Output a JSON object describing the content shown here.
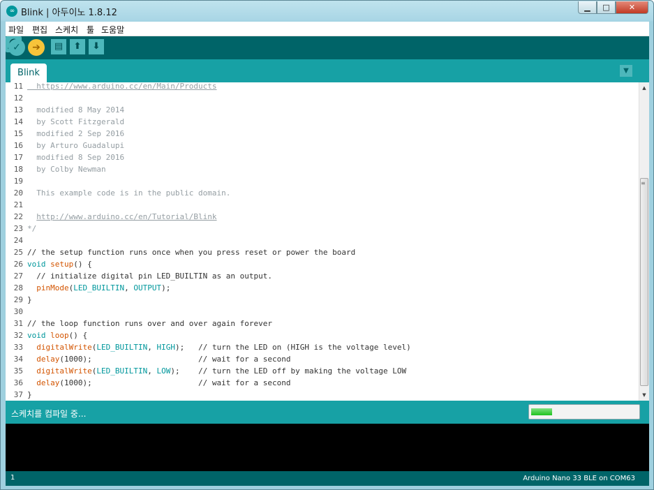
{
  "window": {
    "title": "Blink | 아두이노 1.8.12",
    "controls": {
      "minimize": "▁",
      "maximize": "□",
      "close": "✕"
    },
    "app_icon": "∞"
  },
  "menubar": {
    "items": [
      {
        "label": "파일"
      },
      {
        "label": "편집"
      },
      {
        "label": "스케치"
      },
      {
        "label": "툴"
      },
      {
        "label": "도움말"
      }
    ]
  },
  "toolbar": {
    "verify_icon": "✓",
    "upload_icon": "➔",
    "new_icon": "▤",
    "open_icon": "⬆",
    "save_icon": "⬇",
    "serial_monitor_icon": "serial-monitor-icon"
  },
  "tabs": {
    "active": "Blink",
    "menu_icon": "▼"
  },
  "editor": {
    "lines": [
      {
        "n": "11",
        "tokens": [
          {
            "t": "  https://www.arduino.cc/en/Main/Products",
            "c": "link"
          }
        ]
      },
      {
        "n": "12",
        "tokens": []
      },
      {
        "n": "13",
        "tokens": [
          {
            "t": "  modified 8 May 2014",
            "c": "comment"
          }
        ]
      },
      {
        "n": "14",
        "tokens": [
          {
            "t": "  by Scott Fitzgerald",
            "c": "comment"
          }
        ]
      },
      {
        "n": "15",
        "tokens": [
          {
            "t": "  modified 2 Sep 2016",
            "c": "comment"
          }
        ]
      },
      {
        "n": "16",
        "tokens": [
          {
            "t": "  by Arturo Guadalupi",
            "c": "comment"
          }
        ]
      },
      {
        "n": "17",
        "tokens": [
          {
            "t": "  modified 8 Sep 2016",
            "c": "comment"
          }
        ]
      },
      {
        "n": "18",
        "tokens": [
          {
            "t": "  by Colby Newman",
            "c": "comment"
          }
        ]
      },
      {
        "n": "19",
        "tokens": []
      },
      {
        "n": "20",
        "tokens": [
          {
            "t": "  This example code is in the public domain.",
            "c": "comment"
          }
        ]
      },
      {
        "n": "21",
        "tokens": []
      },
      {
        "n": "22",
        "tokens": [
          {
            "t": "  ",
            "c": "comment"
          },
          {
            "t": "http://www.arduino.cc/en/Tutorial/Blink",
            "c": "link"
          }
        ]
      },
      {
        "n": "23",
        "tokens": [
          {
            "t": "*/",
            "c": "comment"
          }
        ]
      },
      {
        "n": "24",
        "tokens": []
      },
      {
        "n": "25",
        "tokens": [
          {
            "t": "// the setup function runs once when you press reset or power the board",
            "c": "plain"
          }
        ]
      },
      {
        "n": "26",
        "tokens": [
          {
            "t": "void",
            "c": "keyword"
          },
          {
            "t": " ",
            "c": "plain"
          },
          {
            "t": "setup",
            "c": "function"
          },
          {
            "t": "() {",
            "c": "plain"
          }
        ]
      },
      {
        "n": "27",
        "tokens": [
          {
            "t": "  // initialize digital pin LED_BUILTIN as an output.",
            "c": "plain"
          }
        ]
      },
      {
        "n": "28",
        "tokens": [
          {
            "t": "  ",
            "c": "plain"
          },
          {
            "t": "pinMode",
            "c": "function"
          },
          {
            "t": "(",
            "c": "plain"
          },
          {
            "t": "LED_BUILTIN",
            "c": "const"
          },
          {
            "t": ", ",
            "c": "plain"
          },
          {
            "t": "OUTPUT",
            "c": "const"
          },
          {
            "t": ");",
            "c": "plain"
          }
        ]
      },
      {
        "n": "29",
        "tokens": [
          {
            "t": "}",
            "c": "plain"
          }
        ]
      },
      {
        "n": "30",
        "tokens": []
      },
      {
        "n": "31",
        "tokens": [
          {
            "t": "// the loop function runs over and over again forever",
            "c": "plain"
          }
        ]
      },
      {
        "n": "32",
        "tokens": [
          {
            "t": "void",
            "c": "keyword"
          },
          {
            "t": " ",
            "c": "plain"
          },
          {
            "t": "loop",
            "c": "function"
          },
          {
            "t": "() {",
            "c": "plain"
          }
        ]
      },
      {
        "n": "33",
        "tokens": [
          {
            "t": "  ",
            "c": "plain"
          },
          {
            "t": "digitalWrite",
            "c": "function"
          },
          {
            "t": "(",
            "c": "plain"
          },
          {
            "t": "LED_BUILTIN",
            "c": "const"
          },
          {
            "t": ", ",
            "c": "plain"
          },
          {
            "t": "HIGH",
            "c": "const"
          },
          {
            "t": ");   // turn the LED on (HIGH is the voltage level)",
            "c": "plain"
          }
        ]
      },
      {
        "n": "34",
        "tokens": [
          {
            "t": "  ",
            "c": "plain"
          },
          {
            "t": "delay",
            "c": "function"
          },
          {
            "t": "(1000);                       // wait for a second",
            "c": "plain"
          }
        ]
      },
      {
        "n": "35",
        "tokens": [
          {
            "t": "  ",
            "c": "plain"
          },
          {
            "t": "digitalWrite",
            "c": "function"
          },
          {
            "t": "(",
            "c": "plain"
          },
          {
            "t": "LED_BUILTIN",
            "c": "const"
          },
          {
            "t": ", ",
            "c": "plain"
          },
          {
            "t": "LOW",
            "c": "const"
          },
          {
            "t": ");    // turn the LED off by making the voltage LOW",
            "c": "plain"
          }
        ]
      },
      {
        "n": "36",
        "tokens": [
          {
            "t": "  ",
            "c": "plain"
          },
          {
            "t": "delay",
            "c": "function"
          },
          {
            "t": "(1000);                       // wait for a second",
            "c": "plain"
          }
        ]
      },
      {
        "n": "37",
        "tokens": [
          {
            "t": "}",
            "c": "plain"
          }
        ]
      }
    ]
  },
  "scrollbar": {
    "up_icon": "▲",
    "down_icon": "▼",
    "grip": "≡"
  },
  "status": {
    "message": "스케치를 컴파일 중...",
    "progress_fraction": 0.2
  },
  "console": {
    "text": ""
  },
  "footer": {
    "line_number": "1",
    "board": "Arduino Nano 33 BLE on COM63"
  },
  "colors": {
    "teal_dark": "#006468",
    "teal": "#17a1a5",
    "keyword": "#00979c",
    "function": "#d35400",
    "comment": "#959ea3"
  }
}
